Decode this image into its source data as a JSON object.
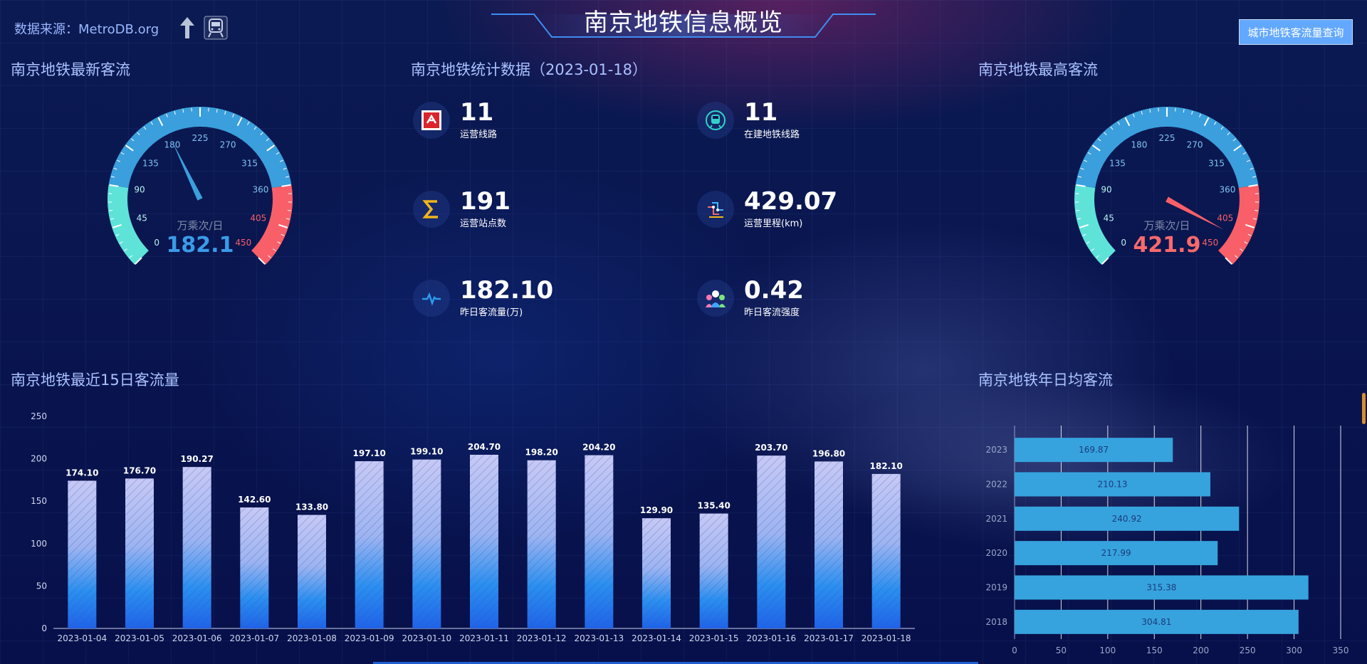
{
  "header": {
    "title": "南京地铁信息概览",
    "source": "数据来源：MetroDB.org",
    "query_button": "城市地铁客流量查询"
  },
  "icons": [
    "up-arrow-icon",
    "train-icon"
  ],
  "sections": {
    "latest_flow": "南京地铁最新客流",
    "stats": "南京地铁统计数据（2023-01-18）",
    "max_flow": "南京地铁最高客流",
    "last15": "南京地铁最近15日客流量",
    "yearly": "南京地铁年日均客流"
  },
  "gauge_latest": {
    "unit": "万乘次/日",
    "value": "182.1",
    "value_num": 182.1,
    "ticks": [
      "0",
      "45",
      "90",
      "135",
      "180",
      "225",
      "270",
      "315",
      "360",
      "405",
      "450"
    ],
    "max": 450,
    "color_value": "#3a9be8"
  },
  "gauge_max": {
    "unit": "万乘次/日",
    "value": "421.9",
    "value_num": 421.9,
    "ticks": [
      "0",
      "45",
      "90",
      "135",
      "180",
      "225",
      "270",
      "315",
      "360",
      "405",
      "450"
    ],
    "max": 450,
    "color_value": "#f8696b"
  },
  "colors": {
    "gauge_low": "#5fe3d9",
    "gauge_mid": "#3a9fdc",
    "gauge_high": "#f95f68",
    "bar_top": "#c7c9f5",
    "bar_bottom": "#1f63e8",
    "hbar": "#36a3de"
  },
  "stats": [
    {
      "icon": "subway-logo-icon",
      "value": "11",
      "label": "运营线路"
    },
    {
      "icon": "metro-train-icon",
      "value": "11",
      "label": "在建地铁线路"
    },
    {
      "icon": "sigma-icon",
      "value": "191",
      "label": "运营站点数"
    },
    {
      "icon": "route-map-icon",
      "value": "429.07",
      "label": "运营里程(km)"
    },
    {
      "icon": "pulse-line-icon",
      "value": "182.10",
      "label": "昨日客流量(万)"
    },
    {
      "icon": "people-group-icon",
      "value": "0.42",
      "label": "昨日客流强度"
    }
  ],
  "chart_data": [
    {
      "type": "bar",
      "categories": [
        "2023-01-04",
        "2023-01-05",
        "2023-01-06",
        "2023-01-07",
        "2023-01-08",
        "2023-01-09",
        "2023-01-10",
        "2023-01-11",
        "2023-01-12",
        "2023-01-13",
        "2023-01-14",
        "2023-01-15",
        "2023-01-16",
        "2023-01-17",
        "2023-01-18"
      ],
      "values": [
        174.1,
        176.7,
        190.27,
        142.6,
        133.8,
        197.1,
        199.1,
        204.7,
        198.2,
        204.2,
        129.9,
        135.4,
        203.7,
        196.8,
        182.1
      ],
      "labels": [
        "174.10",
        "176.70",
        "190.27",
        "142.60",
        "133.80",
        "197.10",
        "199.10",
        "204.70",
        "198.20",
        "204.20",
        "129.90",
        "135.40",
        "203.70",
        "196.80",
        "182.10"
      ],
      "ylim": [
        0,
        250
      ],
      "yticks": [
        "0",
        "50",
        "100",
        "150",
        "200",
        "250"
      ],
      "grid": false
    },
    {
      "type": "bar",
      "orientation": "horizontal",
      "categories": [
        "2023",
        "2022",
        "2021",
        "2020",
        "2019",
        "2018"
      ],
      "values": [
        169.87,
        210.13,
        240.92,
        217.99,
        315.38,
        304.81
      ],
      "labels": [
        "169.87",
        "210.13",
        "240.92",
        "217.99",
        "315.38",
        "304.81"
      ],
      "xlim": [
        0,
        350
      ],
      "xticks": [
        "0",
        "50",
        "100",
        "150",
        "200",
        "250",
        "300",
        "350"
      ],
      "grid": true
    }
  ]
}
